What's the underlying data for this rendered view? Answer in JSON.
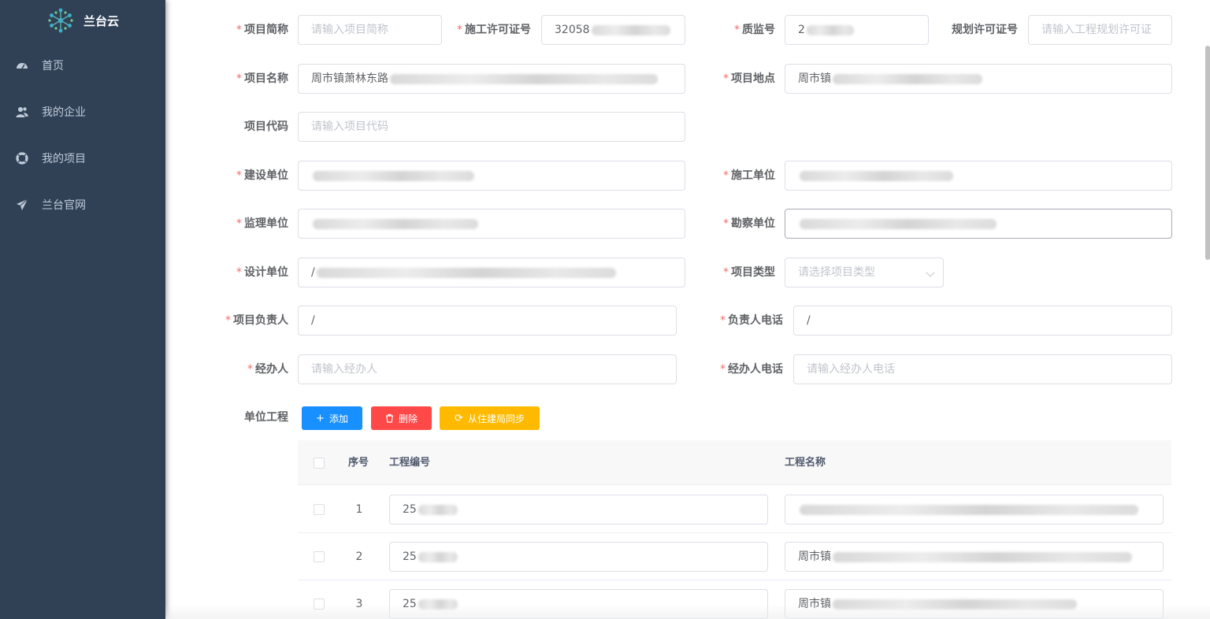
{
  "app": {
    "name": "兰台云"
  },
  "sidebar": {
    "items": [
      {
        "label": "首页",
        "icon": "dashboard-icon"
      },
      {
        "label": "我的企业",
        "icon": "user-group-icon"
      },
      {
        "label": "我的项目",
        "icon": "lifebuoy-icon"
      },
      {
        "label": "兰台官网",
        "icon": "paper-plane-icon"
      }
    ]
  },
  "form": {
    "project_short_name": {
      "label": "项目简称",
      "required": true,
      "placeholder": "请输入项目简称",
      "value": ""
    },
    "construction_permit_no": {
      "label": "施工许可证号",
      "required": true,
      "value": "32058"
    },
    "quality_supervision_no": {
      "label": "质监号",
      "required": true,
      "value": "2"
    },
    "planning_permit_no": {
      "label": "规划许可证号",
      "required": false,
      "placeholder": "请输入工程规划许可证",
      "value": ""
    },
    "project_name": {
      "label": "项目名称",
      "required": true,
      "value": "周市镇萧林东路"
    },
    "project_location": {
      "label": "项目地点",
      "required": true,
      "value": "周市镇"
    },
    "project_code": {
      "label": "项目代码",
      "required": false,
      "placeholder": "请输入项目代码",
      "value": ""
    },
    "construction_unit": {
      "label": "建设单位",
      "required": true,
      "value": ""
    },
    "contractor_unit": {
      "label": "施工单位",
      "required": true,
      "value": ""
    },
    "supervision_unit": {
      "label": "监理单位",
      "required": true,
      "value": ""
    },
    "survey_unit": {
      "label": "勘察单位",
      "required": true,
      "value": ""
    },
    "design_unit": {
      "label": "设计单位",
      "required": true,
      "value": "/"
    },
    "project_type": {
      "label": "项目类型",
      "required": true,
      "placeholder": "请选择项目类型",
      "value": ""
    },
    "project_manager": {
      "label": "项目负责人",
      "required": true,
      "value": "/"
    },
    "manager_phone": {
      "label": "负责人电话",
      "required": true,
      "value": "/"
    },
    "handler": {
      "label": "经办人",
      "required": true,
      "placeholder": "请输入经办人",
      "value": ""
    },
    "handler_phone": {
      "label": "经办人电话",
      "required": true,
      "placeholder": "请输入经办人电话",
      "value": ""
    }
  },
  "unit_projects": {
    "label": "单位工程",
    "buttons": {
      "add": "添加",
      "delete": "删除",
      "sync": "从住建局同步"
    },
    "columns": [
      "序号",
      "工程编号",
      "工程名称"
    ],
    "rows": [
      {
        "index": "1",
        "code": "25",
        "name": ""
      },
      {
        "index": "2",
        "code": "25",
        "name": "周市镇"
      },
      {
        "index": "3",
        "code": "25",
        "name": "周市镇"
      }
    ]
  },
  "colors": {
    "sidebar_bg": "#304156",
    "primary": "#1890ff",
    "danger": "#ff4949",
    "warning": "#ffba00",
    "required": "#f56c6c"
  }
}
